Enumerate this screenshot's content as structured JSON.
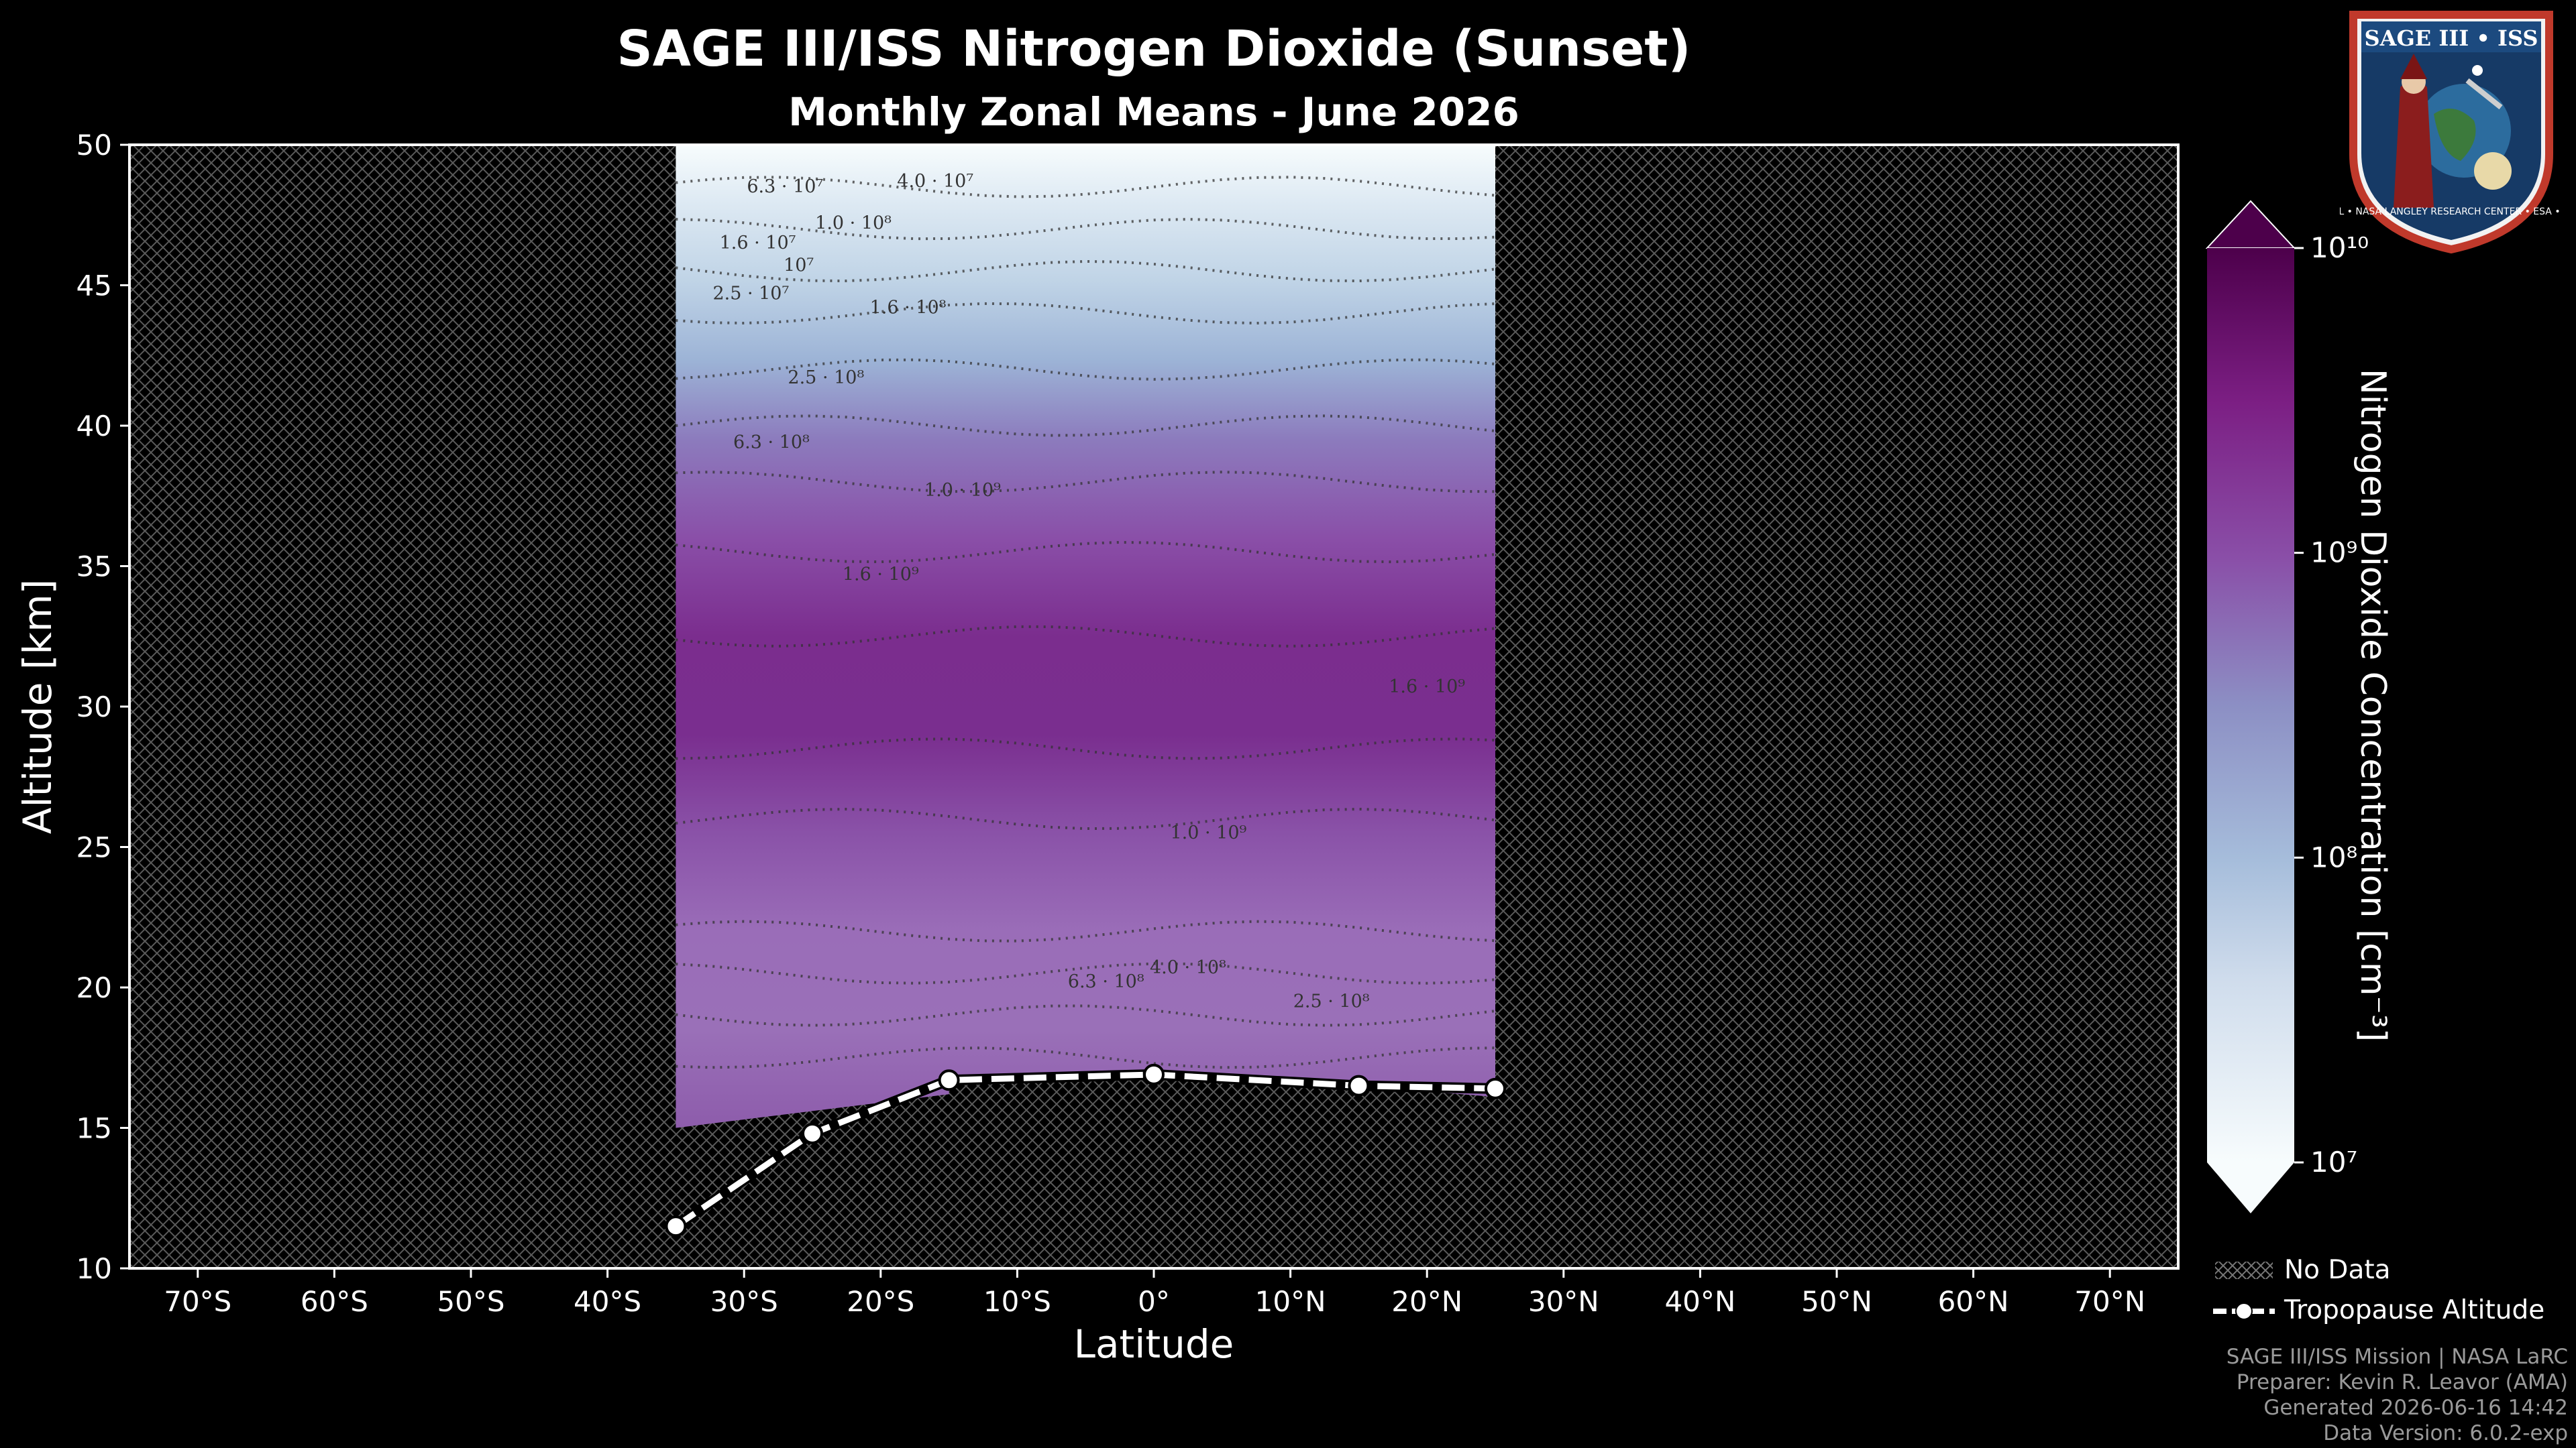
{
  "header": {
    "title": "SAGE III/ISS Nitrogen Dioxide (Sunset)",
    "subtitle": "Monthly Zonal Means - June 2026"
  },
  "logo": {
    "text": "SAGE III • ISS",
    "ring_text": "BALL • NASA LANGLEY RESEARCH CENTER • ESA • ESA"
  },
  "chart_data": {
    "type": "heatmap",
    "title": "SAGE III/ISS Nitrogen Dioxide (Sunset)",
    "subtitle": "Monthly Zonal Means - June 2026",
    "xlabel": "Latitude",
    "ylabel": "Altitude [km]",
    "xlim": [
      -75,
      75
    ],
    "ylim": [
      10,
      50
    ],
    "x_ticks": [
      -70,
      -60,
      -50,
      -40,
      -30,
      -20,
      -10,
      0,
      10,
      20,
      30,
      40,
      50,
      60,
      70
    ],
    "x_tick_labels": [
      "70°S",
      "60°S",
      "50°S",
      "40°S",
      "30°S",
      "20°S",
      "10°S",
      "0°",
      "10°N",
      "20°N",
      "30°N",
      "40°N",
      "50°N",
      "60°N",
      "70°N"
    ],
    "y_ticks": [
      10,
      15,
      20,
      25,
      30,
      35,
      40,
      45,
      50
    ],
    "data_extent": {
      "lat_min": -35,
      "lat_max": 25,
      "alt_max": 50
    },
    "data_bottom_profile": [
      [
        -35,
        15.0
      ],
      [
        -15,
        16.2
      ],
      [
        -15,
        16.7
      ],
      [
        0,
        16.9
      ],
      [
        15,
        16.5
      ],
      [
        25,
        16.1
      ]
    ],
    "colorbar": {
      "label": "Nitrogen Dioxide Concentration [cm⁻³]",
      "scale": "log",
      "range": [
        10000000.0,
        10000000000.0
      ],
      "tick_labels": [
        "10⁷",
        "10⁸",
        "10⁹",
        "10¹⁰"
      ],
      "extend": "both",
      "colors": [
        "#f7fcfd",
        "#bfd3e6",
        "#8c96c6",
        "#88419d",
        "#6e016b"
      ]
    },
    "contour_labels": [
      "1.6 · 10⁷",
      "2.5 · 10⁷",
      "4.0 · 10⁷",
      "6.3 · 10⁷",
      "10⁷",
      "1.0 · 10⁸",
      "1.6 · 10⁸",
      "2.5 · 10⁸",
      "6.3 · 10⁸",
      "1.0 · 10⁹",
      "1.6 · 10⁹",
      "1.6 · 10⁹",
      "1.0 · 10⁹",
      "4.0 · 10⁸",
      "6.3 · 10⁸",
      "2.5 · 10⁸"
    ],
    "series": [
      {
        "name": "Tropopause Altitude",
        "x": [
          -35,
          -25,
          -15,
          0,
          15,
          25
        ],
        "y": [
          11.5,
          14.8,
          16.7,
          16.9,
          16.5,
          16.4
        ]
      }
    ],
    "legend": {
      "placement": "below colorbar",
      "entries": [
        "No Data",
        "Tropopause Altitude"
      ]
    }
  },
  "credits": {
    "line1": "SAGE III/ISS Mission | NASA LaRC",
    "line2": "Preparer: Kevin R. Leavor (AMA)",
    "line3": "Generated 2026-06-16 14:42",
    "line4": "Data Version: 6.0.2-exp"
  }
}
